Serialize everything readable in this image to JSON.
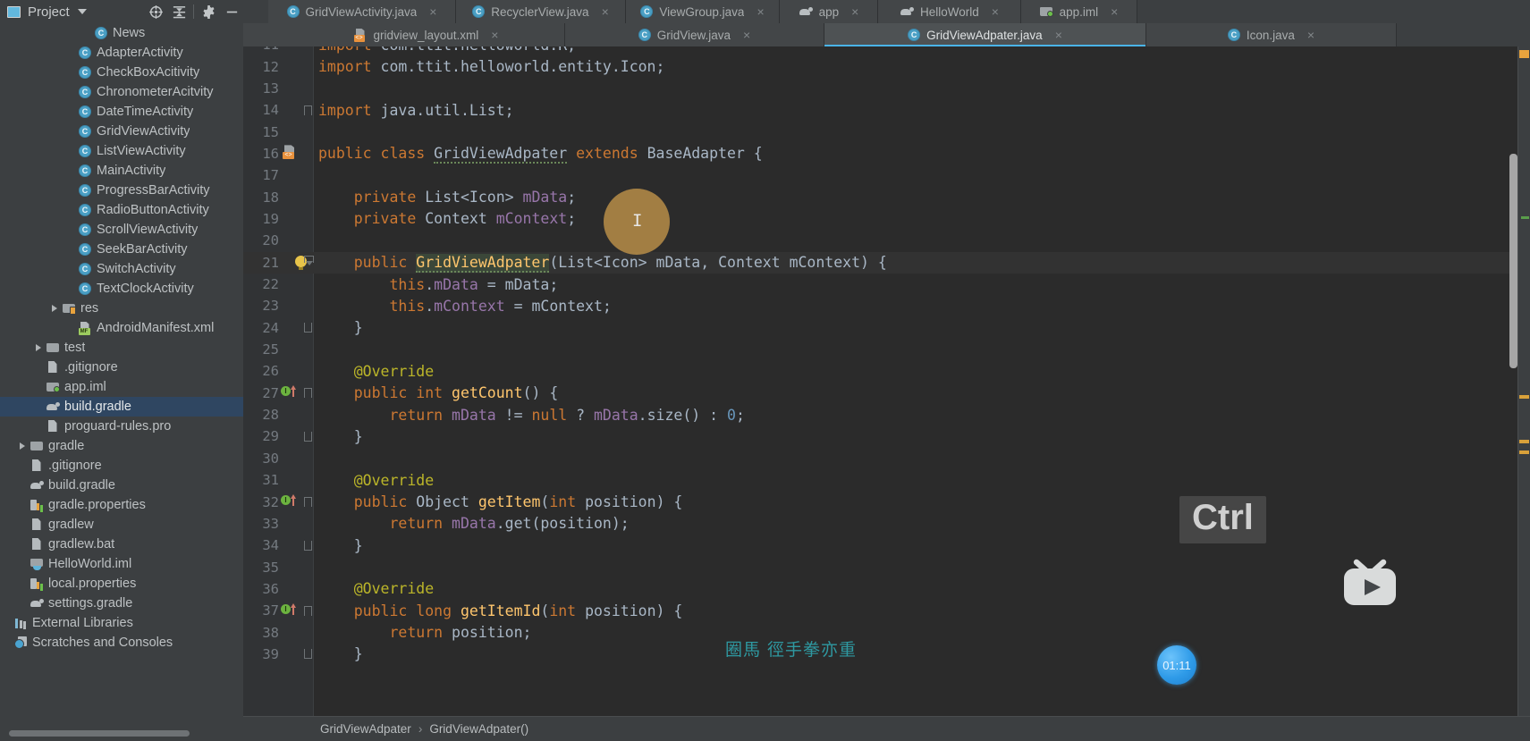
{
  "toolbar": {
    "project_label": "Project",
    "icons": [
      "locate-icon",
      "collapse-all-icon",
      "settings-gear-icon",
      "minimize-icon"
    ]
  },
  "tabs_row1": [
    {
      "label": "GridViewActivity.java",
      "icon": "java-class-icon",
      "active": false,
      "close": "×"
    },
    {
      "label": "RecyclerView.java",
      "icon": "java-class-icon",
      "active": false,
      "close": "×"
    },
    {
      "label": "ViewGroup.java",
      "icon": "java-class-icon",
      "active": false,
      "close": "×"
    },
    {
      "label": "app",
      "icon": "gradle-icon",
      "active": false,
      "close": "×"
    },
    {
      "label": "HelloWorld",
      "icon": "gradle-icon",
      "active": false,
      "close": "×"
    },
    {
      "label": "app.iml",
      "icon": "module-iml-icon",
      "active": false,
      "close": "×"
    }
  ],
  "tabs_row2": [
    {
      "label": "gridview_layout.xml",
      "icon": "xml-layout-icon",
      "active": false,
      "close": "×"
    },
    {
      "label": "GridView.java",
      "icon": "java-class-icon",
      "active": false,
      "close": "×"
    },
    {
      "label": "GridViewAdpater.java",
      "icon": "java-class-icon",
      "active": true,
      "close": "×"
    },
    {
      "label": "Icon.java",
      "icon": "java-class-icon",
      "active": false,
      "close": "×"
    }
  ],
  "sidebar": {
    "items": [
      {
        "label": "News",
        "icon": "java-class-icon",
        "indent": 5,
        "arrow": false,
        "selected": false
      },
      {
        "label": "AdapterActivity",
        "icon": "java-class-icon",
        "indent": 4,
        "arrow": false,
        "selected": false
      },
      {
        "label": "CheckBoxAcitivity",
        "icon": "java-class-icon",
        "indent": 4,
        "arrow": false,
        "selected": false
      },
      {
        "label": "ChronometerAcitvity",
        "icon": "java-class-icon",
        "indent": 4,
        "arrow": false,
        "selected": false
      },
      {
        "label": "DateTimeActivity",
        "icon": "java-class-icon",
        "indent": 4,
        "arrow": false,
        "selected": false
      },
      {
        "label": "GridViewActivity",
        "icon": "java-class-icon",
        "indent": 4,
        "arrow": false,
        "selected": false
      },
      {
        "label": "ListViewActivity",
        "icon": "java-class-icon",
        "indent": 4,
        "arrow": false,
        "selected": false
      },
      {
        "label": "MainActivity",
        "icon": "java-class-icon",
        "indent": 4,
        "arrow": false,
        "selected": false
      },
      {
        "label": "ProgressBarActivity",
        "icon": "java-class-icon",
        "indent": 4,
        "arrow": false,
        "selected": false
      },
      {
        "label": "RadioButtonActivity",
        "icon": "java-class-icon",
        "indent": 4,
        "arrow": false,
        "selected": false
      },
      {
        "label": "ScrollViewActivity",
        "icon": "java-class-icon",
        "indent": 4,
        "arrow": false,
        "selected": false
      },
      {
        "label": "SeekBarActivity",
        "icon": "java-class-icon",
        "indent": 4,
        "arrow": false,
        "selected": false
      },
      {
        "label": "SwitchActivity",
        "icon": "java-class-icon",
        "indent": 4,
        "arrow": false,
        "selected": false
      },
      {
        "label": "TextClockActivity",
        "icon": "java-class-icon",
        "indent": 4,
        "arrow": false,
        "selected": false
      },
      {
        "label": "res",
        "icon": "folder-res-icon",
        "indent": 3,
        "arrow": true,
        "selected": false
      },
      {
        "label": "AndroidManifest.xml",
        "icon": "manifest-icon",
        "indent": 4,
        "arrow": false,
        "selected": false
      },
      {
        "label": "test",
        "icon": "folder-icon",
        "indent": 2,
        "arrow": true,
        "selected": false
      },
      {
        "label": ".gitignore",
        "icon": "file-icon",
        "indent": 2,
        "arrow": false,
        "selected": false
      },
      {
        "label": "app.iml",
        "icon": "module-iml-icon",
        "indent": 2,
        "arrow": false,
        "selected": false
      },
      {
        "label": "build.gradle",
        "icon": "gradle-icon",
        "indent": 2,
        "arrow": false,
        "selected": true
      },
      {
        "label": "proguard-rules.pro",
        "icon": "file-icon",
        "indent": 2,
        "arrow": false,
        "selected": false
      },
      {
        "label": "gradle",
        "icon": "folder-icon",
        "indent": 1,
        "arrow": true,
        "selected": false
      },
      {
        "label": ".gitignore",
        "icon": "file-icon",
        "indent": 1,
        "arrow": false,
        "selected": false
      },
      {
        "label": "build.gradle",
        "icon": "gradle-icon",
        "indent": 1,
        "arrow": false,
        "selected": false
      },
      {
        "label": "gradle.properties",
        "icon": "properties-icon",
        "indent": 1,
        "arrow": false,
        "selected": false
      },
      {
        "label": "gradlew",
        "icon": "file-icon",
        "indent": 1,
        "arrow": false,
        "selected": false
      },
      {
        "label": "gradlew.bat",
        "icon": "file-icon",
        "indent": 1,
        "arrow": false,
        "selected": false
      },
      {
        "label": "HelloWorld.iml",
        "icon": "iml-java-icon",
        "indent": 1,
        "arrow": false,
        "selected": false
      },
      {
        "label": "local.properties",
        "icon": "properties-icon",
        "indent": 1,
        "arrow": false,
        "selected": false
      },
      {
        "label": "settings.gradle",
        "icon": "gradle-icon",
        "indent": 1,
        "arrow": false,
        "selected": false
      },
      {
        "label": "External Libraries",
        "icon": "external-libraries-icon",
        "indent": 0,
        "arrow": false,
        "selected": false
      },
      {
        "label": "Scratches and Consoles",
        "icon": "scratches-icon",
        "indent": 0,
        "arrow": false,
        "selected": false
      }
    ]
  },
  "editor": {
    "filename": "GridViewAdpater.java",
    "first_visible_line": 11,
    "lines": [
      {
        "n": 11,
        "clipped": true,
        "tokens": [
          {
            "t": "import ",
            "c": "kw"
          },
          {
            "t": "com.ttit.helloworld.R;",
            "c": "pl"
          }
        ]
      },
      {
        "n": 12,
        "tokens": [
          {
            "t": "import ",
            "c": "kw"
          },
          {
            "t": "com.ttit.helloworld.entity.Icon;",
            "c": "pl"
          }
        ]
      },
      {
        "n": 13,
        "tokens": []
      },
      {
        "n": 14,
        "fold": "fold-top",
        "tokens": [
          {
            "t": "import ",
            "c": "kw"
          },
          {
            "t": "java.util.List;",
            "c": "pl"
          }
        ]
      },
      {
        "n": 15,
        "tokens": []
      },
      {
        "n": 16,
        "mark": "xml-file-marker",
        "tokens": [
          {
            "t": "public class ",
            "c": "kw"
          },
          {
            "t": "GridViewAdpater",
            "c": "cls",
            "err": true
          },
          {
            "t": " ",
            "c": "pl"
          },
          {
            "t": "extends ",
            "c": "kw"
          },
          {
            "t": "BaseAdapter ",
            "c": "cls"
          },
          {
            "t": "{",
            "c": "pl"
          }
        ]
      },
      {
        "n": 17,
        "tokens": []
      },
      {
        "n": 18,
        "tokens": [
          {
            "t": "    ",
            "c": "pl"
          },
          {
            "t": "private ",
            "c": "kw"
          },
          {
            "t": "List<Icon> ",
            "c": "cls"
          },
          {
            "t": "mData",
            "c": "fld"
          },
          {
            "t": ";",
            "c": "pl"
          }
        ]
      },
      {
        "n": 19,
        "tokens": [
          {
            "t": "    ",
            "c": "pl"
          },
          {
            "t": "private ",
            "c": "kw"
          },
          {
            "t": "Context ",
            "c": "cls"
          },
          {
            "t": "mContext",
            "c": "fld"
          },
          {
            "t": ";",
            "c": "pl"
          }
        ]
      },
      {
        "n": 20,
        "tokens": []
      },
      {
        "n": 21,
        "mark": "intention-bulb",
        "fold": "fold-arrow",
        "highlight": true,
        "tokens": [
          {
            "t": "    ",
            "c": "pl"
          },
          {
            "t": "public ",
            "c": "kw"
          },
          {
            "t": "GridViewAdpater",
            "c": "fn",
            "err": true,
            "sel": true
          },
          {
            "t": "(",
            "c": "pl"
          },
          {
            "t": "List<Icon> ",
            "c": "cls"
          },
          {
            "t": "mData",
            "c": "pl"
          },
          {
            "t": ", ",
            "c": "pl"
          },
          {
            "t": "Context ",
            "c": "cls"
          },
          {
            "t": "mContext",
            "c": "pl"
          },
          {
            "t": ") {",
            "c": "pl"
          }
        ]
      },
      {
        "n": 22,
        "tokens": [
          {
            "t": "        ",
            "c": "pl"
          },
          {
            "t": "this",
            "c": "kw"
          },
          {
            "t": ".",
            "c": "pl"
          },
          {
            "t": "mData",
            "c": "fld"
          },
          {
            "t": " = mData;",
            "c": "pl"
          }
        ]
      },
      {
        "n": 23,
        "tokens": [
          {
            "t": "        ",
            "c": "pl"
          },
          {
            "t": "this",
            "c": "kw"
          },
          {
            "t": ".",
            "c": "pl"
          },
          {
            "t": "mContext",
            "c": "fld"
          },
          {
            "t": " = mContext;",
            "c": "pl"
          }
        ]
      },
      {
        "n": 24,
        "fold": "fold-bot",
        "tokens": [
          {
            "t": "    }",
            "c": "pl"
          }
        ]
      },
      {
        "n": 25,
        "tokens": []
      },
      {
        "n": 26,
        "tokens": [
          {
            "t": "    @Override",
            "c": "ann"
          }
        ]
      },
      {
        "n": 27,
        "mark": "override-marker",
        "fold": "fold-top",
        "tokens": [
          {
            "t": "    ",
            "c": "pl"
          },
          {
            "t": "public int ",
            "c": "kw"
          },
          {
            "t": "getCount",
            "c": "fn"
          },
          {
            "t": "() {",
            "c": "pl"
          }
        ]
      },
      {
        "n": 28,
        "tokens": [
          {
            "t": "        ",
            "c": "pl"
          },
          {
            "t": "return ",
            "c": "kw"
          },
          {
            "t": "mData ",
            "c": "fld"
          },
          {
            "t": "!= ",
            "c": "pl"
          },
          {
            "t": "null ",
            "c": "kw"
          },
          {
            "t": "? ",
            "c": "pl"
          },
          {
            "t": "mData",
            "c": "fld"
          },
          {
            "t": ".size() : ",
            "c": "pl"
          },
          {
            "t": "0",
            "c": "num"
          },
          {
            "t": ";",
            "c": "pl"
          }
        ]
      },
      {
        "n": 29,
        "fold": "fold-bot",
        "tokens": [
          {
            "t": "    }",
            "c": "pl"
          }
        ]
      },
      {
        "n": 30,
        "tokens": []
      },
      {
        "n": 31,
        "tokens": [
          {
            "t": "    @Override",
            "c": "ann"
          }
        ]
      },
      {
        "n": 32,
        "mark": "override-marker",
        "fold": "fold-top",
        "tokens": [
          {
            "t": "    ",
            "c": "pl"
          },
          {
            "t": "public ",
            "c": "kw"
          },
          {
            "t": "Object ",
            "c": "cls"
          },
          {
            "t": "getItem",
            "c": "fn"
          },
          {
            "t": "(",
            "c": "pl"
          },
          {
            "t": "int ",
            "c": "kw"
          },
          {
            "t": "position",
            "c": "pl"
          },
          {
            "t": ") {",
            "c": "pl"
          }
        ]
      },
      {
        "n": 33,
        "tokens": [
          {
            "t": "        ",
            "c": "pl"
          },
          {
            "t": "return ",
            "c": "kw"
          },
          {
            "t": "mData",
            "c": "fld"
          },
          {
            "t": ".get(position);",
            "c": "pl"
          }
        ]
      },
      {
        "n": 34,
        "fold": "fold-bot",
        "tokens": [
          {
            "t": "    }",
            "c": "pl"
          }
        ]
      },
      {
        "n": 35,
        "tokens": []
      },
      {
        "n": 36,
        "tokens": [
          {
            "t": "    @Override",
            "c": "ann"
          }
        ]
      },
      {
        "n": 37,
        "mark": "override-marker",
        "fold": "fold-top",
        "tokens": [
          {
            "t": "    ",
            "c": "pl"
          },
          {
            "t": "public long ",
            "c": "kw"
          },
          {
            "t": "getItemId",
            "c": "fn"
          },
          {
            "t": "(",
            "c": "pl"
          },
          {
            "t": "int ",
            "c": "kw"
          },
          {
            "t": "position",
            "c": "pl"
          },
          {
            "t": ") {",
            "c": "pl"
          }
        ]
      },
      {
        "n": 38,
        "tokens": [
          {
            "t": "        ",
            "c": "pl"
          },
          {
            "t": "return ",
            "c": "kw"
          },
          {
            "t": "position;",
            "c": "pl"
          }
        ]
      },
      {
        "n": 39,
        "fold": "fold-bot",
        "clipped": true,
        "tokens": [
          {
            "t": "    }",
            "c": "pl"
          }
        ]
      }
    ],
    "breadcrumb": {
      "class": "GridViewAdpater",
      "separator": "›",
      "method": "GridViewAdpater()"
    }
  },
  "overlays": {
    "modifier_key": "Ctrl",
    "timer": "01:11",
    "watermark": "圈馬 徑手拳亦重",
    "logo": "bilibili-tv-logo"
  },
  "colors": {
    "accent": "#4ab4e8",
    "selection": "#2f4661",
    "editor_bg": "#2b2b2b",
    "panel_bg": "#3c3f41",
    "gutter_bg": "#313335",
    "keyword": "#cc7832",
    "annotation": "#bbb529",
    "method": "#ffc66d",
    "field": "#9876aa",
    "number": "#6897bb",
    "plain": "#a9b7c6"
  }
}
